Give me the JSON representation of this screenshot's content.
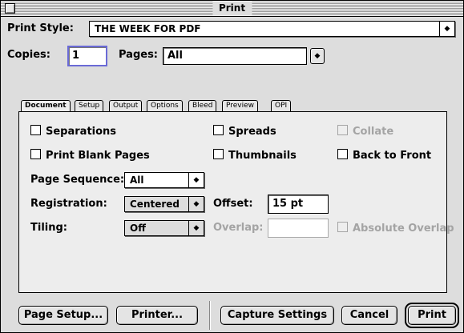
{
  "window": {
    "title": "Print"
  },
  "print_style": {
    "label": "Print Style:",
    "value": "THE WEEK FOR PDF"
  },
  "copies": {
    "label": "Copies:",
    "value": "1"
  },
  "pages": {
    "label": "Pages:",
    "value": "All"
  },
  "tabs": [
    {
      "label": "Document",
      "active": true
    },
    {
      "label": "Setup"
    },
    {
      "label": "Output"
    },
    {
      "label": "Options"
    },
    {
      "label": "Bleed"
    },
    {
      "label": "Preview"
    },
    {
      "label": "OPI"
    }
  ],
  "document": {
    "separations": "Separations",
    "spreads": "Spreads",
    "collate": "Collate",
    "print_blank_pages": "Print Blank Pages",
    "thumbnails": "Thumbnails",
    "back_to_front": "Back to Front",
    "page_sequence": {
      "label": "Page Sequence:",
      "value": "All"
    },
    "registration": {
      "label": "Registration:",
      "value": "Centered"
    },
    "offset": {
      "label": "Offset:",
      "value": "15 pt"
    },
    "tiling": {
      "label": "Tiling:",
      "value": "Off"
    },
    "overlap": {
      "label": "Overlap:",
      "value": ""
    },
    "absolute_overlap": "Absolute Overlap"
  },
  "buttons": {
    "page_setup": "Page Setup...",
    "printer": "Printer...",
    "capture_settings": "Capture Settings",
    "cancel": "Cancel",
    "print": "Print"
  },
  "icons": {
    "popup_arrow": "updown-arrows-icon",
    "close_box": "close-box-icon"
  }
}
